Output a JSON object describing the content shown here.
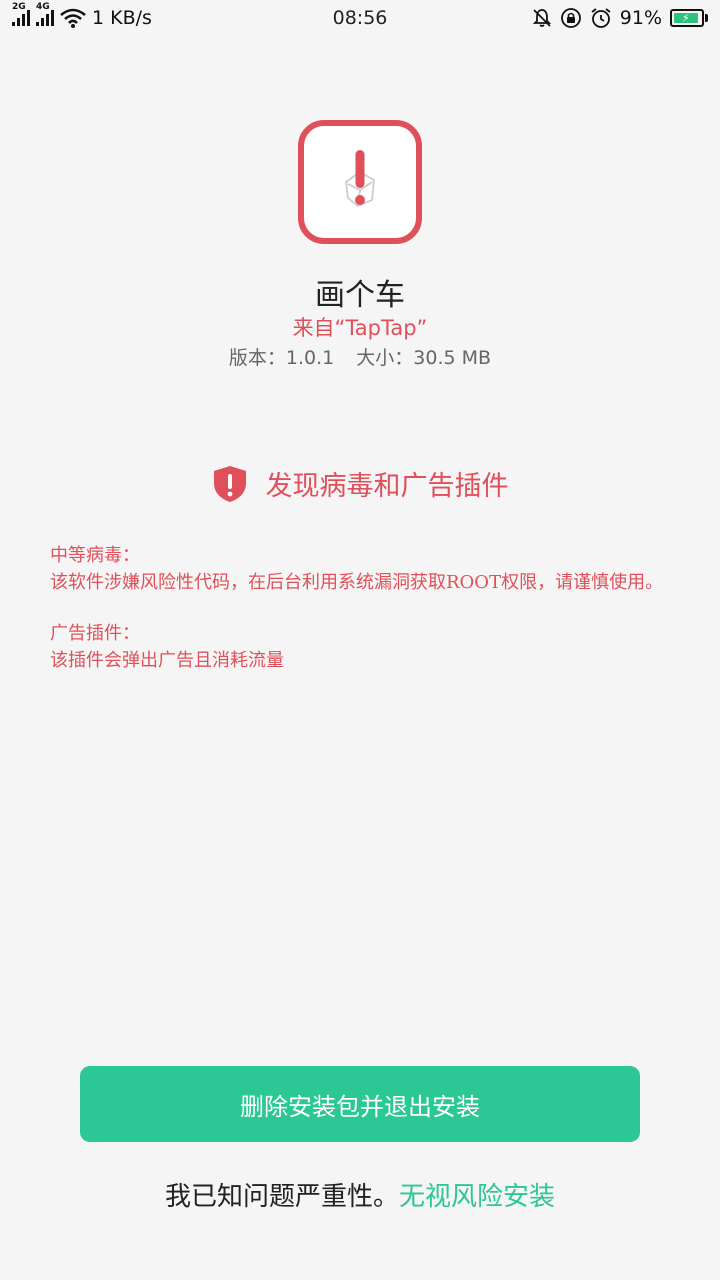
{
  "status_bar": {
    "network_1": "2G",
    "network_2": "4G",
    "speed": "1 KB/s",
    "time": "08:56",
    "battery_percent": "91%",
    "battery_level": 0.91
  },
  "app": {
    "name": "画个车",
    "source": "来自“TapTap”",
    "version": "版本：1.0.1",
    "size": "大小：30.5 MB"
  },
  "warning": {
    "title": "发现病毒和广告插件",
    "virus_label": "中等病毒：",
    "virus_desc": "该软件涉嫌风险性代码，在后台利用系统漏洞获取ROOT权限，请谨慎使用。",
    "plugin_label": "广告插件：",
    "plugin_desc": "该插件会弹出广告且消耗流量"
  },
  "actions": {
    "delete_button": "删除安装包并退出安装",
    "ack_text": "我已知问题严重性。",
    "ignore_link": "无视风险安装"
  },
  "colors": {
    "danger": "#e0505a",
    "accent": "#2bc795",
    "background": "#f5f5f5"
  }
}
